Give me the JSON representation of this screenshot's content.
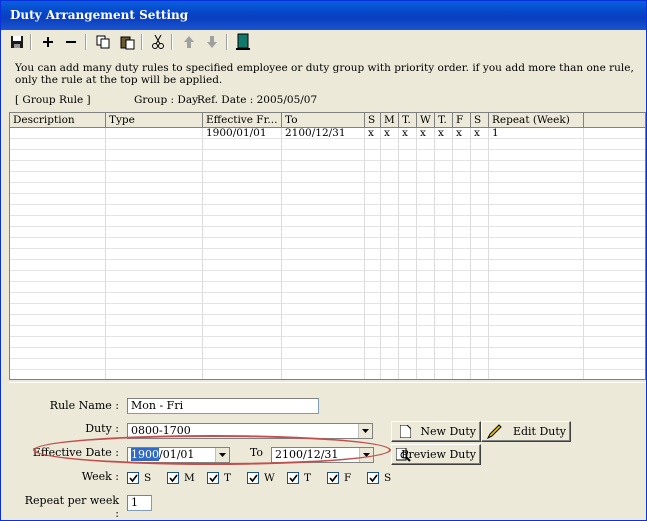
{
  "window": {
    "title": "Duty Arrangement Setting"
  },
  "toolbar": {
    "buttons": [
      {
        "name": "save-icon"
      },
      {
        "name": "add-icon"
      },
      {
        "name": "remove-icon"
      },
      {
        "name": "copy-icon"
      },
      {
        "name": "paste-icon"
      },
      {
        "name": "cut-icon"
      },
      {
        "name": "arrow-up-icon"
      },
      {
        "name": "arrow-down-icon"
      },
      {
        "name": "exit-door-icon"
      }
    ]
  },
  "info": {
    "text": "You can add many duty rules to specified employee or duty group with priority order. if you add more than one rule, only the rule at the top will be applied.",
    "group_rule": "[ Group Rule ]",
    "group": "Group : Day",
    "ref_date": "Ref. Date : 2005/05/07"
  },
  "grid": {
    "headers": [
      "Description",
      "Type",
      "Effective Fr...",
      "To",
      "S",
      "M",
      "T.",
      "W",
      "T.",
      "F",
      "S",
      "Repeat (Week)"
    ],
    "rows": [
      [
        "",
        "",
        "1900/01/01",
        "2100/12/31",
        "x",
        "x",
        "x",
        "x",
        "x",
        "x",
        "x",
        "1"
      ]
    ]
  },
  "form": {
    "rule_name_label": "Rule Name :",
    "rule_name_value": "Mon - Fri",
    "duty_label": "Duty :",
    "duty_value": "0800-1700",
    "new_duty": "New Duty",
    "edit_duty": "Edit Duty",
    "effective_date_label": "Effective Date :",
    "effective_from_sel": "1900",
    "effective_from_rest": "/01/01",
    "to_label": "To",
    "to_value": "2100/12/31",
    "preview_duty": "Preview Duty",
    "week_label": "Week :",
    "days": [
      {
        "label": "S",
        "checked": true
      },
      {
        "label": "M",
        "checked": true
      },
      {
        "label": "T",
        "checked": true
      },
      {
        "label": "W",
        "checked": true
      },
      {
        "label": "T",
        "checked": true
      },
      {
        "label": "F",
        "checked": true
      },
      {
        "label": "S",
        "checked": true
      }
    ],
    "repeat_label": "Repeat per week :",
    "repeat_value": "1"
  },
  "colors": {
    "titlebar": "#0a4fd4",
    "highlight_oval": "#c0504d",
    "selection": "#316ac5"
  }
}
